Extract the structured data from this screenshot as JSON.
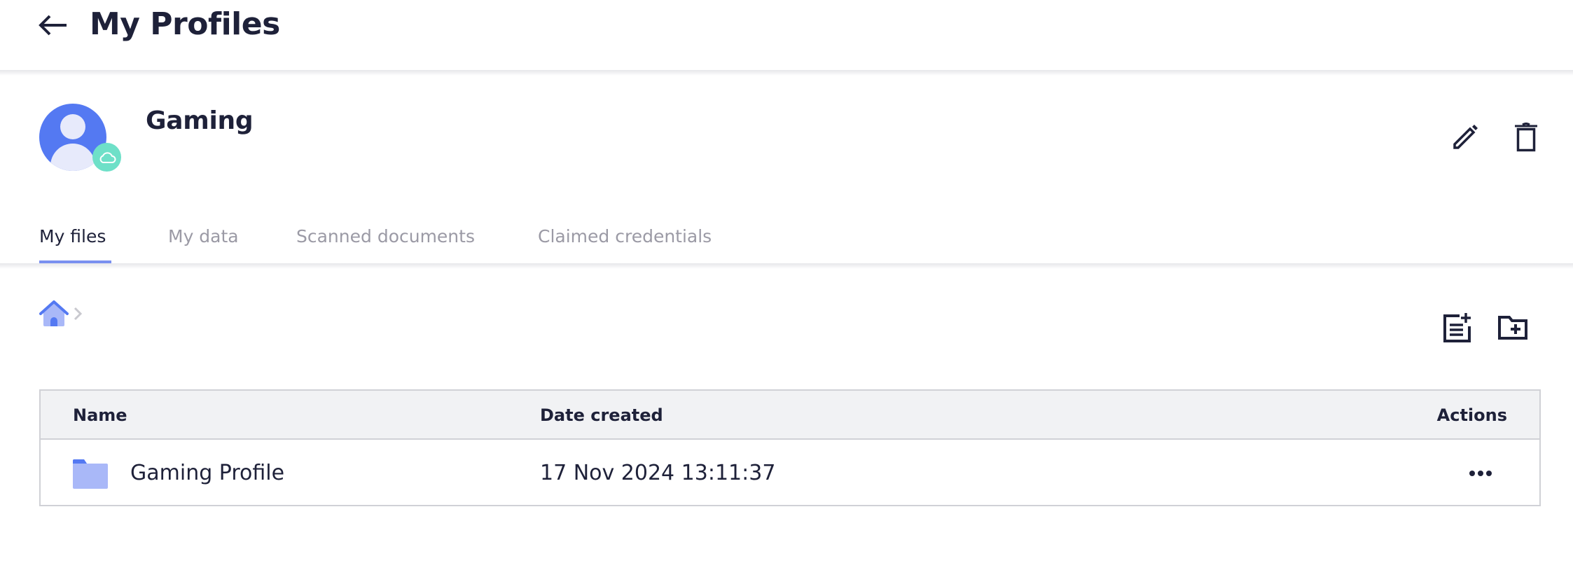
{
  "header": {
    "title": "My Profiles",
    "back_icon": "arrow-left-icon"
  },
  "profile": {
    "name": "Gaming",
    "avatar_icon": "user-avatar-icon",
    "badge_icon": "cloud-icon",
    "actions": {
      "edit_icon": "pencil-icon",
      "delete_icon": "trash-icon"
    }
  },
  "tabs": [
    {
      "label": "My files",
      "active": true
    },
    {
      "label": "My data",
      "active": false
    },
    {
      "label": "Scanned documents",
      "active": false
    },
    {
      "label": "Claimed credentials",
      "active": false
    }
  ],
  "breadcrumb": {
    "home_icon": "home-icon",
    "separator_icon": "chevron-right-icon"
  },
  "toolbar": {
    "add_note_icon": "note-add-icon",
    "add_folder_icon": "folder-add-icon"
  },
  "table": {
    "columns": [
      "Name",
      "Date created",
      "Actions"
    ],
    "rows": [
      {
        "type": "folder",
        "name": "Gaming Profile",
        "date_created": "17 Nov 2024 13:11:37",
        "actions_icon": "more-horizontal-icon"
      }
    ]
  },
  "colors": {
    "text": "#1e2139",
    "accent": "#5479f2",
    "accent_light": "#a9b8f8",
    "tab_inactive": "#9b9aa5",
    "badge": "#6ee0c8",
    "table_header_bg": "#f1f2f4",
    "border": "#d0d1d6"
  }
}
